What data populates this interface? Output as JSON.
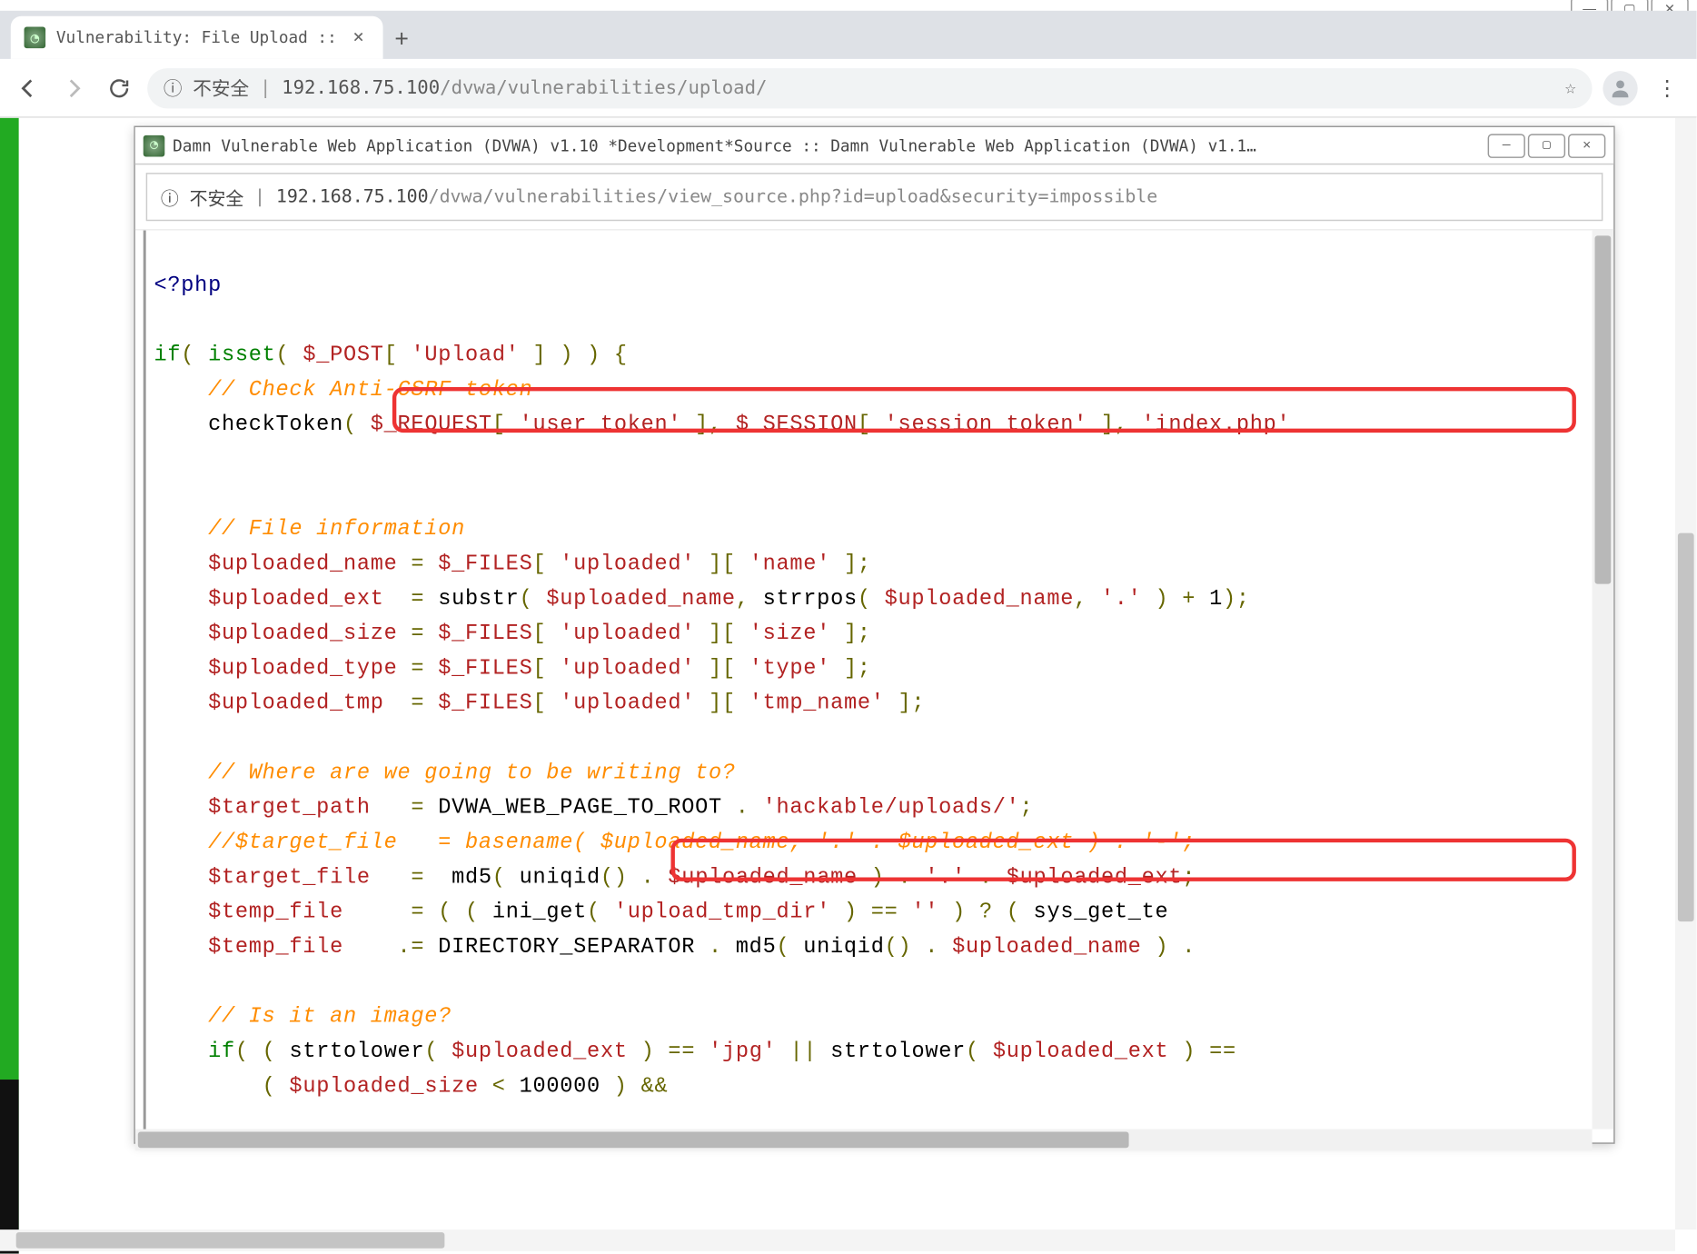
{
  "outer": {
    "tab_title": "Vulnerability: File Upload ::",
    "address_insecure": "不安全",
    "address_host": "192.168.75.100",
    "address_path": "/dvwa/vulnerabilities/upload/"
  },
  "inner": {
    "title": "Damn Vulnerable Web Application (DVWA) v1.10 *Development*Source :: Damn Vulnerable Web Application (DVWA) v1.1…",
    "address_insecure": "不安全",
    "address_host": "192.168.75.100",
    "address_path": "/dvwa/vulnerabilities/view_source.php?id=upload&security=impossible"
  },
  "code": {
    "open_tag": "<?php",
    "if_open": "if( isset( $_POST[ 'Upload' ] ) ) {",
    "comment_csrf": "// Check Anti-CSRF token",
    "check_token": "checkToken( $_REQUEST[ 'user_token' ], $_SESSION[ 'session_token' ], 'index.php'",
    "comment_fileinfo": "// File information",
    "up_name": "$uploaded_name = $_FILES[ 'uploaded' ][ 'name' ];",
    "up_ext": "$uploaded_ext   = substr( $uploaded_name, strrpos( $uploaded_name, '.' ) + 1);",
    "up_size": "$uploaded_size = $_FILES[ 'uploaded' ][ 'size' ];",
    "up_type": "$uploaded_type = $_FILES[ 'uploaded' ][ 'type' ];",
    "up_tmp": "$uploaded_tmp   = $_FILES[ 'uploaded' ][ 'tmp_name' ];",
    "comment_where": "// Where are we going to be writing to?",
    "target_path": "$target_path    = DVWA_WEB_PAGE_TO_ROOT . 'hackable/uploads/';",
    "target_file_comment": "//$target_file     = basename( $uploaded_name, '.' . $uploaded_ext ) . '-';",
    "target_file": "$target_file    =  md5( uniqid() . $uploaded_name ) . '.' . $uploaded_ext;",
    "temp_file1": "$temp_file       = ( ( ini_get( 'upload_tmp_dir' ) == '' ) ? ( sys_get_te",
    "temp_file2": "$temp_file      .= DIRECTORY_SEPARATOR . md5( uniqid() . $uploaded_name ) .",
    "comment_isimage": "// Is it an image?",
    "if_image": "if( ( strtolower( $uploaded_ext ) == 'jpg' || strtolower( $uploaded_ext ) ==",
    "if_size": "( $uploaded_size < 100000 ) &&"
  }
}
